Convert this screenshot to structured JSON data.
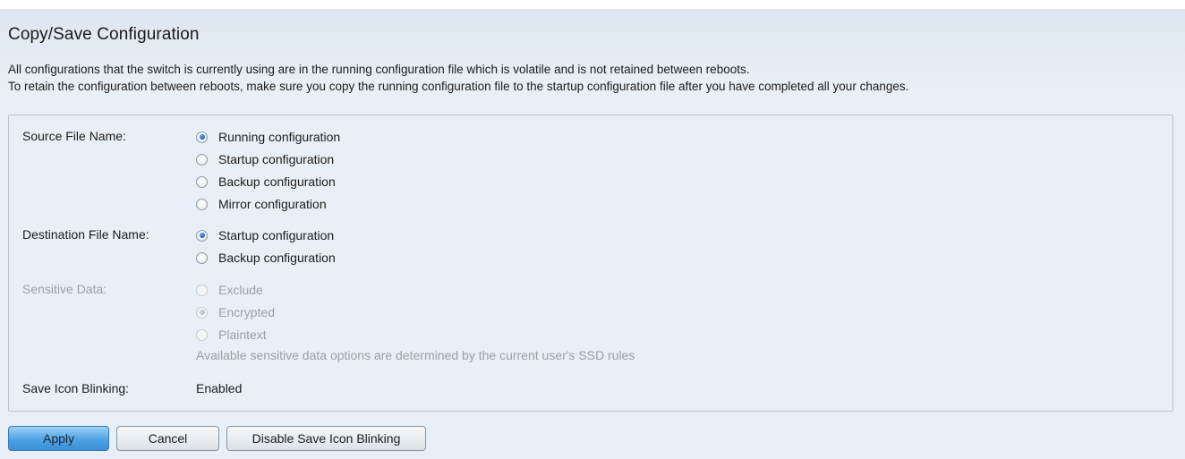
{
  "page": {
    "title": "Copy/Save Configuration",
    "description_lines": [
      "All configurations that the switch is currently using are in the running configuration file which is volatile and is not retained between reboots.",
      "To retain the configuration between reboots, make sure you copy the running configuration file to the startup configuration file after you have completed all your changes."
    ]
  },
  "form": {
    "source": {
      "label": "Source File Name:",
      "options": [
        "Running configuration",
        "Startup configuration",
        "Backup configuration",
        "Mirror configuration"
      ],
      "selected": "Running configuration"
    },
    "destination": {
      "label": "Destination File Name:",
      "options": [
        "Startup configuration",
        "Backup configuration"
      ],
      "selected": "Startup configuration"
    },
    "sensitive": {
      "label": "Sensitive Data:",
      "options": [
        "Exclude",
        "Encrypted",
        "Plaintext"
      ],
      "selected": "Encrypted",
      "disabled": true,
      "note": "Available sensitive data options are determined by the current user's SSD rules"
    },
    "blinking": {
      "label": "Save Icon Blinking:",
      "value": "Enabled"
    }
  },
  "buttons": {
    "apply": "Apply",
    "cancel": "Cancel",
    "disable_blinking": "Disable Save Icon Blinking"
  },
  "colors": {
    "background": "#e9eff6",
    "panel_border": "#b9c4d0",
    "primary_button": "#4ea3e6",
    "disabled_text": "#9aa0a7"
  }
}
